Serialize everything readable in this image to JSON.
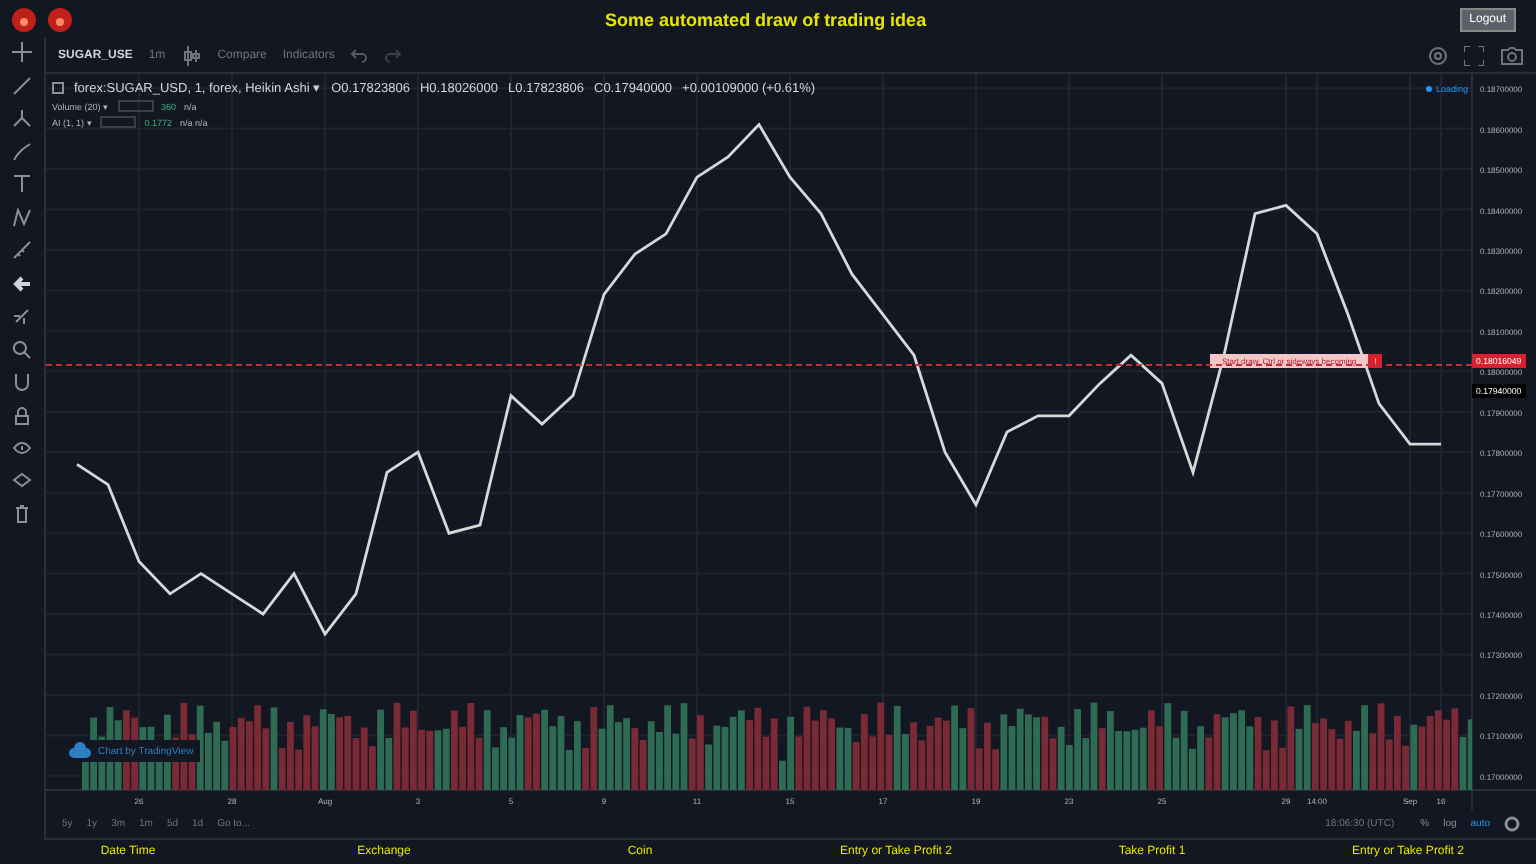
{
  "header": {
    "title": "Some automated draw of trading idea",
    "logout": "Logout"
  },
  "toolbar": {
    "symbol": "SUGAR_USE",
    "interval": "1m",
    "compare": "Compare",
    "indicators": "Indicators"
  },
  "legend": {
    "ohlc": [
      "O0.17823806",
      "H0.18026000",
      "L0.17823806",
      "C0.17940000"
    ],
    "change": "+0.00109000 (+0.61%)",
    "studies": [
      {
        "name": "Volume (20) ▾",
        "value": "360",
        "extra": "n/a"
      },
      {
        "name": "AI (1, 1) ▾",
        "value": "0.1772",
        "extra": "n/a  n/a"
      }
    ]
  },
  "loading": "Loading",
  "price_labels": [
    {
      "text": "0.18016049",
      "kind": "alert"
    },
    {
      "text": "0.17940000",
      "kind": "last"
    }
  ],
  "alert": {
    "text": "Start draw. Ctrl or sideways becoming",
    "button": "!"
  },
  "credit": "Chart by TradingView",
  "chart_data": {
    "type": "line",
    "grid": true,
    "ylim": [
      0.16965,
      0.18735
    ],
    "categories": [
      null,
      null,
      "26",
      null,
      null,
      "28",
      null,
      null,
      "Aug",
      null,
      null,
      "3",
      null,
      null,
      "5",
      null,
      null,
      "9",
      null,
      null,
      "11",
      null,
      null,
      "15",
      null,
      null,
      "17",
      null,
      null,
      "19",
      null,
      null,
      "23",
      null,
      null,
      "25",
      null,
      null,
      null,
      "29",
      "14:00",
      null,
      null,
      "Sep",
      "16"
    ],
    "yticks": [
      {
        "value": 0.187,
        "label": "0.18700000"
      },
      {
        "value": 0.186,
        "label": "0.18600000"
      },
      {
        "value": 0.185,
        "label": "0.18500000"
      },
      {
        "value": 0.184,
        "label": "0.18400000"
      },
      {
        "value": 0.183,
        "label": "0.18300000"
      },
      {
        "value": 0.182,
        "label": "0.18200000"
      },
      {
        "value": 0.181,
        "label": "0.18100000"
      },
      {
        "value": 0.18,
        "label": "0.18000000"
      },
      {
        "value": 0.179,
        "label": "0.17900000"
      },
      {
        "value": 0.178,
        "label": "0.17800000"
      },
      {
        "value": 0.177,
        "label": "0.17700000"
      },
      {
        "value": 0.176,
        "label": "0.17600000"
      },
      {
        "value": 0.175,
        "label": "0.17500000"
      },
      {
        "value": 0.174,
        "label": "0.17400000"
      },
      {
        "value": 0.173,
        "label": "0.17300000"
      },
      {
        "value": 0.172,
        "label": "0.17200000"
      },
      {
        "value": 0.171,
        "label": "0.17100000"
      },
      {
        "value": 0.17,
        "label": "0.17000000"
      }
    ],
    "series": [
      {
        "name": "forex:SUGAR_USD, 1, forex, Heikin Ashi ▾",
        "color": "#d8d8d8",
        "values": [
          0.1777,
          0.1772,
          0.1753,
          0.1745,
          0.175,
          0.1745,
          0.174,
          0.175,
          0.1735,
          0.1745,
          0.1775,
          0.178,
          0.176,
          0.1762,
          0.1794,
          0.1787,
          0.1794,
          0.1819,
          0.1829,
          0.1834,
          0.1848,
          0.1853,
          0.1861,
          0.1848,
          0.1839,
          0.1824,
          0.1814,
          0.1804,
          0.178,
          0.1767,
          0.1785,
          0.1789,
          0.1789,
          0.1797,
          0.1804,
          0.1797,
          0.1775,
          0.1804,
          0.1839,
          0.1841,
          0.1834,
          0.1814,
          0.1792,
          0.1782,
          0.1782
        ]
      }
    ]
  },
  "ranges": [
    "5y",
    "1y",
    "3m",
    "1m",
    "5d",
    "1d",
    "Go to..."
  ],
  "clock": "18:06:30 (UTC)",
  "scale_options": [
    {
      "label": "%",
      "selected": false
    },
    {
      "label": "log",
      "selected": false
    },
    {
      "label": "auto",
      "selected": true
    }
  ],
  "footer": [
    "Date Time",
    "Exchange",
    "Coin",
    "Entry or Take Profit 2",
    "Take Profit 1",
    "Entry or Take Profit 2"
  ]
}
